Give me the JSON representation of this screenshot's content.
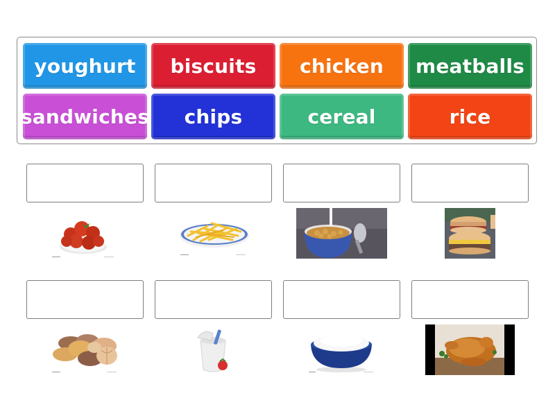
{
  "word_bank": {
    "tiles": [
      {
        "label": "youghurt",
        "color": "#2196e6"
      },
      {
        "label": "biscuits",
        "color": "#dc1e32"
      },
      {
        "label": "chicken",
        "color": "#f77310"
      },
      {
        "label": "meatballs",
        "color": "#1e8a46"
      },
      {
        "label": "sandwiches",
        "color": "#c84fd6"
      },
      {
        "label": "chips",
        "color": "#2232d6"
      },
      {
        "label": "cereal",
        "color": "#3cb880"
      },
      {
        "label": "rice",
        "color": "#f24414"
      }
    ]
  },
  "drop_targets": [
    {
      "image": "meatballs-image",
      "answer": ""
    },
    {
      "image": "chips-image",
      "answer": ""
    },
    {
      "image": "cereal-image",
      "answer": ""
    },
    {
      "image": "sandwiches-image",
      "answer": ""
    },
    {
      "image": "biscuits-image",
      "answer": ""
    },
    {
      "image": "yoghurt-image",
      "answer": ""
    },
    {
      "image": "rice-image",
      "answer": ""
    },
    {
      "image": "chicken-image",
      "answer": ""
    }
  ]
}
